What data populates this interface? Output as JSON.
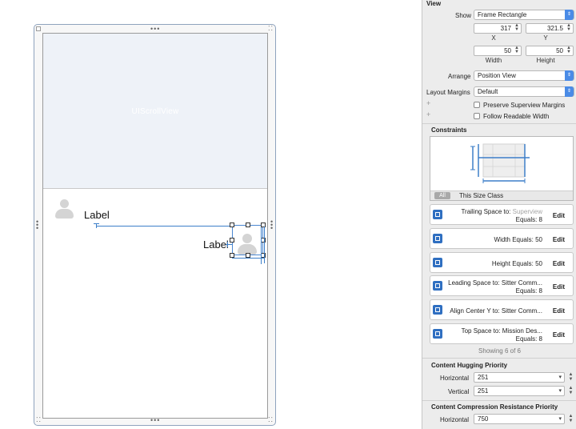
{
  "canvas": {
    "scroll_view_label": "UIScrollView",
    "label_1": "Label",
    "label_2": "Label"
  },
  "inspector": {
    "section_title": "View",
    "show_label": "Show",
    "show_value": "Frame Rectangle",
    "x_value": "317",
    "x_caption": "X",
    "y_value": "321.5",
    "y_caption": "Y",
    "width_value": "50",
    "width_caption": "Width",
    "height_value": "50",
    "height_caption": "Height",
    "arrange_label": "Arrange",
    "arrange_value": "Position View",
    "layout_margins_label": "Layout Margins",
    "layout_margins_value": "Default",
    "preserve_superview_margins": "Preserve Superview Margins",
    "follow_readable_width": "Follow Readable Width",
    "constraints_title": "Constraints",
    "tab_all": "All",
    "tab_size_class": "This Size Class",
    "constraints": [
      {
        "line1_label": "Trailing Space to:",
        "line1_value": "Superview",
        "line2": "Equals:  8",
        "edit": "Edit"
      },
      {
        "single": "Width Equals:  50",
        "edit": "Edit"
      },
      {
        "single": "Height Equals:  50",
        "edit": "Edit"
      },
      {
        "line1_label": "Leading Space to:",
        "line1_value": "Sitter Comm...",
        "line2": "Equals:  8",
        "edit": "Edit"
      },
      {
        "single_label": "Align Center Y to:",
        "single_value": "Sitter Comm...",
        "edit": "Edit"
      },
      {
        "line1_label": "Top Space to:",
        "line1_value": "Mission Des...",
        "line2": "Equals:  8",
        "edit": "Edit"
      }
    ],
    "showing_count": "Showing 6 of 6",
    "content_hugging_title": "Content Hugging Priority",
    "hugging_horizontal_label": "Horizontal",
    "hugging_horizontal_value": "251",
    "hugging_vertical_label": "Vertical",
    "hugging_vertical_value": "251",
    "compression_title": "Content Compression Resistance Priority",
    "compression_horizontal_label": "Horizontal",
    "compression_horizontal_value": "750"
  }
}
